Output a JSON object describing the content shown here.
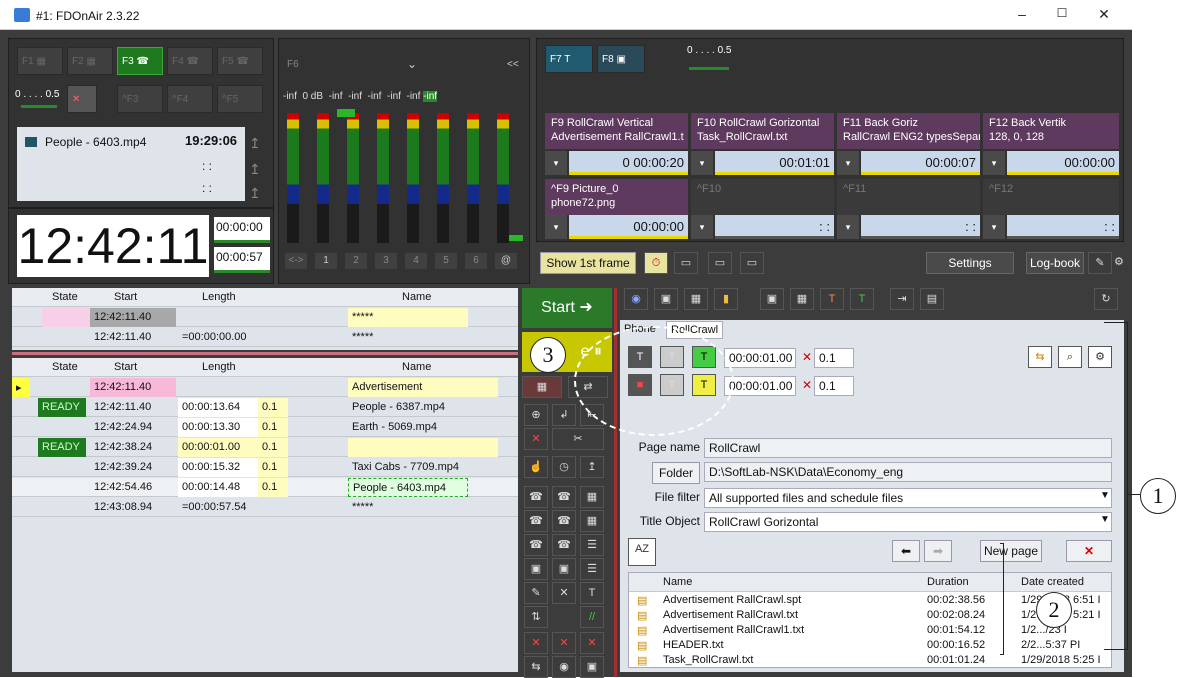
{
  "window": {
    "title": "#1: FDOnAir 2.3.22",
    "min": "–",
    "max": "☐",
    "close": "✕"
  },
  "fkeys_left": [
    {
      "label": "F1"
    },
    {
      "label": "F2"
    },
    {
      "label": "F3",
      "active": true
    },
    {
      "label": "F4"
    },
    {
      "label": "F5"
    },
    {
      "label": "^F3"
    },
    {
      "label": "^F4"
    },
    {
      "label": "^F5"
    }
  ],
  "slider_left": {
    "scale": "0 . . . . 0.5"
  },
  "clip": {
    "name": "People - 6403.mp4",
    "time1": "19:29:06",
    "time2": ": :",
    "time3": ": :"
  },
  "clock": {
    "main": "12:42:11",
    "box1": "00:00:00",
    "box2": "00:00:57"
  },
  "audio": {
    "f6": "F6",
    "db_labels": [
      "-inf",
      "0 dB",
      "-inf",
      "-inf",
      "-inf",
      "-inf",
      "-inf",
      "-inf"
    ],
    "collapse": "<<",
    "ch_buttons": [
      "<->",
      "1",
      "2",
      "3",
      "4",
      "5",
      "6",
      "@"
    ]
  },
  "fkeys_right": [
    {
      "label": "F7"
    },
    {
      "label": "F8"
    }
  ],
  "slider_right": {
    "scale": "0 . . . . 0.5"
  },
  "pkeys": [
    {
      "title": "F9 RollCrawl Vertical",
      "sub": "Advertisement RallCrawl1.t",
      "time": "0 00:00:20"
    },
    {
      "title": "F10 RollCrawl Gorizontal",
      "sub": "Task_RollCrawl.txt",
      "time": "00:01:01"
    },
    {
      "title": "F11 Back Goriz",
      "sub": "RallCrawl ENG2 typesSepar",
      "time": "00:00:07"
    },
    {
      "title": "F12 Back Vertik",
      "sub": "128, 0, 128",
      "time": "00:00:00"
    },
    {
      "title": "^F9 Picture_0",
      "sub": "phone72.png",
      "time": "00:00:00"
    },
    {
      "title": "^F10",
      "sub": "",
      "time": ": :"
    },
    {
      "title": "^F11",
      "sub": "",
      "time": ": :"
    },
    {
      "title": "^F12",
      "sub": "",
      "time": ": :"
    }
  ],
  "toolbar": {
    "show_first": "Show 1st frame",
    "settings": "Settings",
    "logbook": "Log-book"
  },
  "top_grid": {
    "headers": [
      "State",
      "Start",
      "Length",
      "Name"
    ],
    "rows": [
      {
        "start": "12:42:11.40",
        "length": "",
        "name": "*****"
      },
      {
        "start": "12:42:11.40",
        "length": "=00:00:00.00",
        "name": "*****"
      }
    ]
  },
  "playlist": {
    "headers": [
      "State",
      "Start",
      "Length",
      "Name"
    ],
    "rows": [
      {
        "state": "",
        "start": "12:42:11.40",
        "length": "",
        "speed": "",
        "name": "Advertisement"
      },
      {
        "state": "READY",
        "start": "12:42:11.40",
        "length": "00:00:13.64",
        "speed": "0.1",
        "name": "People - 6387.mp4"
      },
      {
        "state": "",
        "start": "12:42:24.94",
        "length": "00:00:13.30",
        "speed": "0.1",
        "name": "Earth - 5069.mp4"
      },
      {
        "state": "READY",
        "start": "12:42:38.24",
        "length": "00:00:01.00",
        "speed": "0.1",
        "name": ""
      },
      {
        "state": "",
        "start": "12:42:39.24",
        "length": "00:00:15.32",
        "speed": "0.1",
        "name": "Taxi Cabs - 7709.mp4"
      },
      {
        "state": "",
        "start": "12:42:54.46",
        "length": "00:00:14.48",
        "speed": "0.1",
        "name": "People - 6403.mp4"
      },
      {
        "state": "",
        "start": "12:43:08.94",
        "length": "=00:00:57.54",
        "speed": "",
        "name": "*****"
      }
    ]
  },
  "center": {
    "start": "Start ➜",
    "pause": "e ⏸"
  },
  "right": {
    "tabs": [
      "Phone",
      "RollCrawl"
    ],
    "row1": {
      "time": "00:00:01.00",
      "speed": "0.1"
    },
    "row2": {
      "time": "00:00:01.00",
      "speed": "0.1"
    },
    "page_name_label": "Page name",
    "page_name": "RollCrawl",
    "folder_btn": "Folder",
    "folder": "D:\\SoftLab-NSK\\Data\\Economy_eng",
    "filter_label": "File filter",
    "filter": "All supported files and schedule files",
    "title_obj_label": "Title Object",
    "title_obj": "RollCrawl Gorizontal",
    "new_page": "New page",
    "file_headers": [
      "Name",
      "Duration",
      "Date created"
    ],
    "files": [
      {
        "name": "Advertisement RallCrawl.spt",
        "dur": "00:02:38.56",
        "date": "1/29/2018 6:51 I"
      },
      {
        "name": "Advertisement RallCrawl.txt",
        "dur": "00:02:08.24",
        "date": "1/29/2018 5:21 I"
      },
      {
        "name": "Advertisement RallCrawl1.txt",
        "dur": "00:01:54.12",
        "date": "1/2.../23 I"
      },
      {
        "name": "HEADER.txt",
        "dur": "00:00:16.52",
        "date": "2/2...5:37 PI"
      },
      {
        "name": "Task_RollCrawl.txt",
        "dur": "00:01:01.24",
        "date": "1/29/2018 5:25 I"
      }
    ]
  },
  "callouts": [
    "1",
    "2",
    "3"
  ]
}
